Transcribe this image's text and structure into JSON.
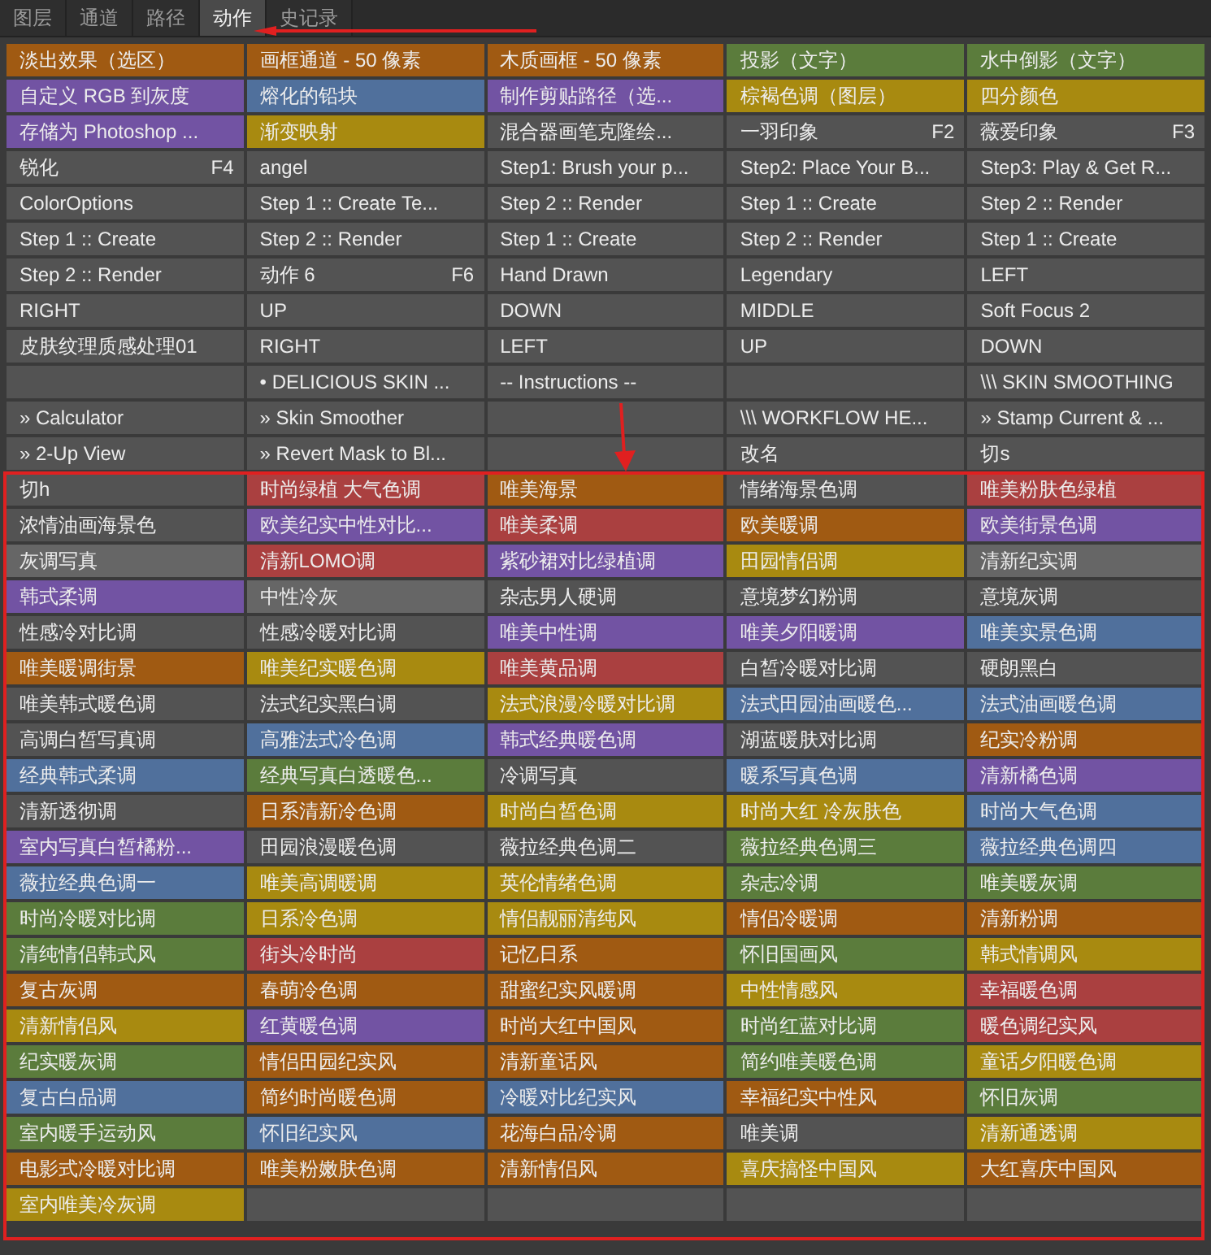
{
  "tabs": [
    {
      "label": "图层",
      "selected": false
    },
    {
      "label": "通道",
      "selected": false
    },
    {
      "label": "路径",
      "selected": false
    },
    {
      "label": "动作",
      "selected": true
    },
    {
      "label": "史记录",
      "selected": false
    }
  ],
  "rows": [
    [
      {
        "label": "淡出效果（选区）",
        "color": "#a05a12"
      },
      {
        "label": "画框通道 - 50 像素",
        "color": "#a05a12"
      },
      {
        "label": "木质画框 - 50 像素",
        "color": "#a05a12"
      },
      {
        "label": "投影（文字）",
        "color": "#5b7c3c"
      },
      {
        "label": "水中倒影（文字）",
        "color": "#5b7c3c"
      }
    ],
    [
      {
        "label": "自定义 RGB 到灰度",
        "color": "#7253a3"
      },
      {
        "label": "熔化的铅块",
        "color": "#50709c"
      },
      {
        "label": "制作剪贴路径（选...",
        "color": "#7253a3"
      },
      {
        "label": "棕褐色调（图层）",
        "color": "#a88a10"
      },
      {
        "label": "四分颜色",
        "color": "#a88a10"
      }
    ],
    [
      {
        "label": "存储为 Photoshop ...",
        "color": "#7253a3"
      },
      {
        "label": "渐变映射",
        "color": "#a88a10"
      },
      {
        "label": "混合器画笔克隆绘...",
        "color": "#535353"
      },
      {
        "label": "一羽印象",
        "shortcut": "F2",
        "color": "#535353"
      },
      {
        "label": "薇爱印象",
        "shortcut": "F3",
        "color": "#535353"
      }
    ],
    [
      {
        "label": "锐化",
        "shortcut": "F4",
        "color": "#535353"
      },
      {
        "label": "angel",
        "color": "#535353"
      },
      {
        "label": "Step1: Brush your p...",
        "color": "#535353"
      },
      {
        "label": "Step2: Place Your B...",
        "color": "#535353"
      },
      {
        "label": "Step3: Play & Get R...",
        "color": "#535353"
      }
    ],
    [
      {
        "label": "ColorOptions",
        "color": "#535353"
      },
      {
        "label": "Step 1 :: Create Te...",
        "color": "#535353"
      },
      {
        "label": "Step 2 :: Render",
        "color": "#535353"
      },
      {
        "label": "Step 1 :: Create",
        "color": "#535353"
      },
      {
        "label": "Step 2 :: Render",
        "color": "#535353"
      }
    ],
    [
      {
        "label": "Step 1 :: Create",
        "color": "#535353"
      },
      {
        "label": "Step 2 :: Render",
        "color": "#535353"
      },
      {
        "label": "Step 1 :: Create",
        "color": "#535353"
      },
      {
        "label": "Step 2 :: Render",
        "color": "#535353"
      },
      {
        "label": "Step 1 :: Create",
        "color": "#535353"
      }
    ],
    [
      {
        "label": "Step 2 :: Render",
        "color": "#535353"
      },
      {
        "label": "动作 6",
        "shortcut": "F6",
        "color": "#535353"
      },
      {
        "label": "Hand Drawn",
        "color": "#535353"
      },
      {
        "label": "Legendary",
        "color": "#535353"
      },
      {
        "label": "LEFT",
        "color": "#535353"
      }
    ],
    [
      {
        "label": "RIGHT",
        "color": "#535353"
      },
      {
        "label": "UP",
        "color": "#535353"
      },
      {
        "label": "DOWN",
        "color": "#535353"
      },
      {
        "label": "MIDDLE",
        "color": "#535353"
      },
      {
        "label": "Soft Focus 2",
        "color": "#535353"
      }
    ],
    [
      {
        "label": "皮肤纹理质感处理01",
        "color": "#535353"
      },
      {
        "label": "RIGHT",
        "color": "#535353"
      },
      {
        "label": "LEFT",
        "color": "#535353"
      },
      {
        "label": "UP",
        "color": "#535353"
      },
      {
        "label": "DOWN",
        "color": "#535353"
      }
    ],
    [
      {
        "color": "#535353"
      },
      {
        "label": "• DELICIOUS SKIN ...",
        "color": "#535353"
      },
      {
        "label": "-- Instructions --",
        "color": "#535353"
      },
      {
        "color": "#535353"
      },
      {
        "label": "\\\\\\ SKIN SMOOTHING",
        "color": "#535353"
      }
    ],
    [
      {
        "label": "» Calculator",
        "color": "#535353"
      },
      {
        "label": "» Skin Smoother",
        "color": "#535353"
      },
      {
        "color": "#535353"
      },
      {
        "label": "\\\\\\ WORKFLOW HE...",
        "color": "#535353"
      },
      {
        "label": "» Stamp Current & ...",
        "color": "#535353"
      }
    ],
    [
      {
        "label": "» 2-Up View",
        "color": "#535353"
      },
      {
        "label": "» Revert Mask to Bl...",
        "color": "#535353"
      },
      {
        "color": "#535353"
      },
      {
        "label": "改名",
        "color": "#535353"
      },
      {
        "label": "切s",
        "color": "#535353"
      }
    ],
    [
      {
        "label": "切h",
        "color": "#535353"
      },
      {
        "label": "时尚绿植 大气色调",
        "color": "#aa4040"
      },
      {
        "label": "唯美海景",
        "color": "#a05a12"
      },
      {
        "label": "情绪海景色调",
        "color": "#535353"
      },
      {
        "label": "唯美粉肤色绿植",
        "color": "#aa4040"
      }
    ],
    [
      {
        "label": "浓情油画海景色",
        "color": "#535353"
      },
      {
        "label": "欧美纪实中性对比...",
        "color": "#7253a3"
      },
      {
        "label": "唯美柔调",
        "color": "#aa4040"
      },
      {
        "label": "欧美暖调",
        "color": "#a05a12"
      },
      {
        "label": "欧美街景色调",
        "color": "#7253a3"
      }
    ],
    [
      {
        "label": "灰调写真",
        "color": "#666666"
      },
      {
        "label": "清新LOMO调",
        "color": "#aa4040"
      },
      {
        "label": "紫砂裙对比绿植调",
        "color": "#7253a3"
      },
      {
        "label": "田园情侣调",
        "color": "#a88a10"
      },
      {
        "label": "清新纪实调",
        "color": "#666666"
      }
    ],
    [
      {
        "label": "韩式柔调",
        "color": "#7253a3"
      },
      {
        "label": "中性冷灰",
        "color": "#666666"
      },
      {
        "label": "杂志男人硬调",
        "color": "#535353"
      },
      {
        "label": "意境梦幻粉调",
        "color": "#535353"
      },
      {
        "label": "意境灰调",
        "color": "#535353"
      }
    ],
    [
      {
        "label": "性感冷对比调",
        "color": "#535353"
      },
      {
        "label": "性感冷暖对比调",
        "color": "#535353"
      },
      {
        "label": "唯美中性调",
        "color": "#7253a3"
      },
      {
        "label": "唯美夕阳暖调",
        "color": "#7253a3"
      },
      {
        "label": "唯美实景色调",
        "color": "#50709c"
      }
    ],
    [
      {
        "label": "唯美暖调街景",
        "color": "#a05a12"
      },
      {
        "label": "唯美纪实暖色调",
        "color": "#a88a10"
      },
      {
        "label": "唯美黄品调",
        "color": "#aa4040"
      },
      {
        "label": "白皙冷暖对比调",
        "color": "#535353"
      },
      {
        "label": "硬朗黑白",
        "color": "#535353"
      }
    ],
    [
      {
        "label": "唯美韩式暖色调",
        "color": "#535353"
      },
      {
        "label": "法式纪实黑白调",
        "color": "#535353"
      },
      {
        "label": "法式浪漫冷暖对比调",
        "color": "#a88a10"
      },
      {
        "label": "法式田园油画暖色...",
        "color": "#50709c"
      },
      {
        "label": "法式油画暖色调",
        "color": "#50709c"
      }
    ],
    [
      {
        "label": "高调白皙写真调",
        "color": "#535353"
      },
      {
        "label": "高雅法式冷色调",
        "color": "#50709c"
      },
      {
        "label": "韩式经典暖色调",
        "color": "#7253a3"
      },
      {
        "label": "湖蓝暖肤对比调",
        "color": "#535353"
      },
      {
        "label": "纪实冷粉调",
        "color": "#a05a12"
      }
    ],
    [
      {
        "label": "经典韩式柔调",
        "color": "#50709c"
      },
      {
        "label": "经典写真白透暖色...",
        "color": "#5b7c3c"
      },
      {
        "label": "冷调写真",
        "color": "#535353"
      },
      {
        "label": "暖系写真色调",
        "color": "#50709c"
      },
      {
        "label": "清新橘色调",
        "color": "#7253a3"
      }
    ],
    [
      {
        "label": "清新透彻调",
        "color": "#535353"
      },
      {
        "label": "日系清新冷色调",
        "color": "#a05a12"
      },
      {
        "label": "时尚白皙色调",
        "color": "#a88a10"
      },
      {
        "label": "时尚大红 冷灰肤色",
        "color": "#a88a10"
      },
      {
        "label": "时尚大气色调",
        "color": "#50709c"
      }
    ],
    [
      {
        "label": "室内写真白皙橘粉...",
        "color": "#7253a3"
      },
      {
        "label": "田园浪漫暖色调",
        "color": "#535353"
      },
      {
        "label": "薇拉经典色调二",
        "color": "#535353"
      },
      {
        "label": "薇拉经典色调三",
        "color": "#5b7c3c"
      },
      {
        "label": "薇拉经典色调四",
        "color": "#50709c"
      }
    ],
    [
      {
        "label": "薇拉经典色调一",
        "color": "#50709c"
      },
      {
        "label": "唯美高调暖调",
        "color": "#a88a10"
      },
      {
        "label": "英伦情绪色调",
        "color": "#a88a10"
      },
      {
        "label": "杂志冷调",
        "color": "#5b7c3c"
      },
      {
        "label": "唯美暖灰调",
        "color": "#5b7c3c"
      }
    ],
    [
      {
        "label": "时尚冷暖对比调",
        "color": "#5b7c3c"
      },
      {
        "label": "日系冷色调",
        "color": "#a88a10"
      },
      {
        "label": "情侣靓丽清纯风",
        "color": "#a88a10"
      },
      {
        "label": "情侣冷暖调",
        "color": "#a05a12"
      },
      {
        "label": "清新粉调",
        "color": "#a05a12"
      }
    ],
    [
      {
        "label": "清纯情侣韩式风",
        "color": "#5b7c3c"
      },
      {
        "label": "街头冷时尚",
        "color": "#aa4040"
      },
      {
        "label": "记忆日系",
        "color": "#a05a12"
      },
      {
        "label": "怀旧国画风",
        "color": "#5b7c3c"
      },
      {
        "label": "韩式情调风",
        "color": "#a88a10"
      }
    ],
    [
      {
        "label": "复古灰调",
        "color": "#a05a12"
      },
      {
        "label": "春萌冷色调",
        "color": "#a05a12"
      },
      {
        "label": "甜蜜纪实风暖调",
        "color": "#a05a12"
      },
      {
        "label": "中性情感风",
        "color": "#a88a10"
      },
      {
        "label": "幸福暖色调",
        "color": "#aa4040"
      }
    ],
    [
      {
        "label": "清新情侣风",
        "color": "#a88a10"
      },
      {
        "label": "红黄暖色调",
        "color": "#7253a3"
      },
      {
        "label": "时尚大红中国风",
        "color": "#a05a12"
      },
      {
        "label": "时尚红蓝对比调",
        "color": "#5b7c3c"
      },
      {
        "label": "暖色调纪实风",
        "color": "#aa4040"
      }
    ],
    [
      {
        "label": "纪实暖灰调",
        "color": "#5b7c3c"
      },
      {
        "label": "情侣田园纪实风",
        "color": "#a05a12"
      },
      {
        "label": "清新童话风",
        "color": "#a05a12"
      },
      {
        "label": "简约唯美暖色调",
        "color": "#5b7c3c"
      },
      {
        "label": "童话夕阳暖色调",
        "color": "#a88a10"
      }
    ],
    [
      {
        "label": "复古白品调",
        "color": "#50709c"
      },
      {
        "label": "简约时尚暖色调",
        "color": "#a05a12"
      },
      {
        "label": "冷暖对比纪实风",
        "color": "#50709c"
      },
      {
        "label": "幸福纪实中性风",
        "color": "#a05a12"
      },
      {
        "label": "怀旧灰调",
        "color": "#5b7c3c"
      }
    ],
    [
      {
        "label": "室内暖手运动风",
        "color": "#5b7c3c"
      },
      {
        "label": "怀旧纪实风",
        "color": "#50709c"
      },
      {
        "label": "花海白品冷调",
        "color": "#a05a12"
      },
      {
        "label": "唯美调",
        "color": "#535353"
      },
      {
        "label": "清新通透调",
        "color": "#a88a10"
      }
    ],
    [
      {
        "label": "电影式冷暖对比调",
        "color": "#a05a12"
      },
      {
        "label": "唯美粉嫩肤色调",
        "color": "#a05a12"
      },
      {
        "label": "清新情侣风",
        "color": "#a05a12"
      },
      {
        "label": "喜庆搞怪中国风",
        "color": "#a88a10"
      },
      {
        "label": "大红喜庆中国风",
        "color": "#a05a12"
      }
    ],
    [
      {
        "label": "室内唯美冷灰调",
        "color": "#a88a10"
      },
      {
        "color": "#535353"
      },
      {
        "color": "#535353"
      },
      {
        "color": "#535353"
      },
      {
        "color": "#535353"
      }
    ]
  ]
}
